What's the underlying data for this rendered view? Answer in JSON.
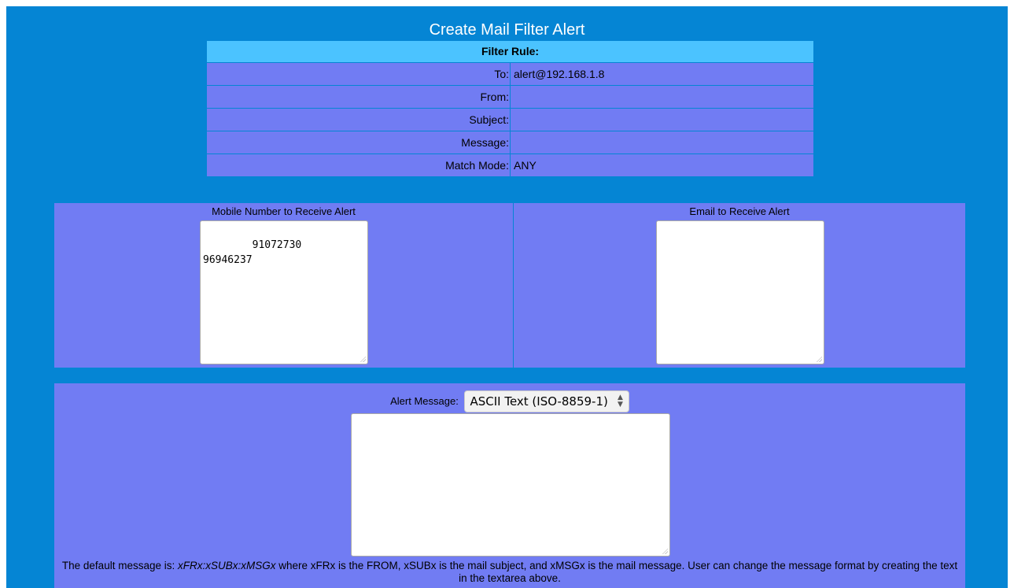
{
  "title": "Create Mail Filter Alert",
  "filter": {
    "heading": "Filter Rule:",
    "rows": [
      {
        "label": "To:",
        "value": "alert@192.168.1.8"
      },
      {
        "label": "From:",
        "value": ""
      },
      {
        "label": "Subject:",
        "value": ""
      },
      {
        "label": "Message:",
        "value": ""
      },
      {
        "label": "Match Mode:",
        "value": "ANY"
      }
    ]
  },
  "recipients": {
    "mobile_label": "Mobile Number to Receive Alert",
    "mobile_value": "91072730\n96946237",
    "email_label": "Email to Receive Alert",
    "email_value": ""
  },
  "alert": {
    "label": "Alert Message:",
    "encoding_selected": "ASCII Text (ISO-8859-1)",
    "message_value": "",
    "note_prefix": "The default message is: ",
    "note_format": "xFRx:xSUBx:xMSGx",
    "note_suffix": " where xFRx is the FROM, xSUBx is the mail subject, and xMSGx is the mail message. User can change the message format by creating the text in the textarea above."
  }
}
